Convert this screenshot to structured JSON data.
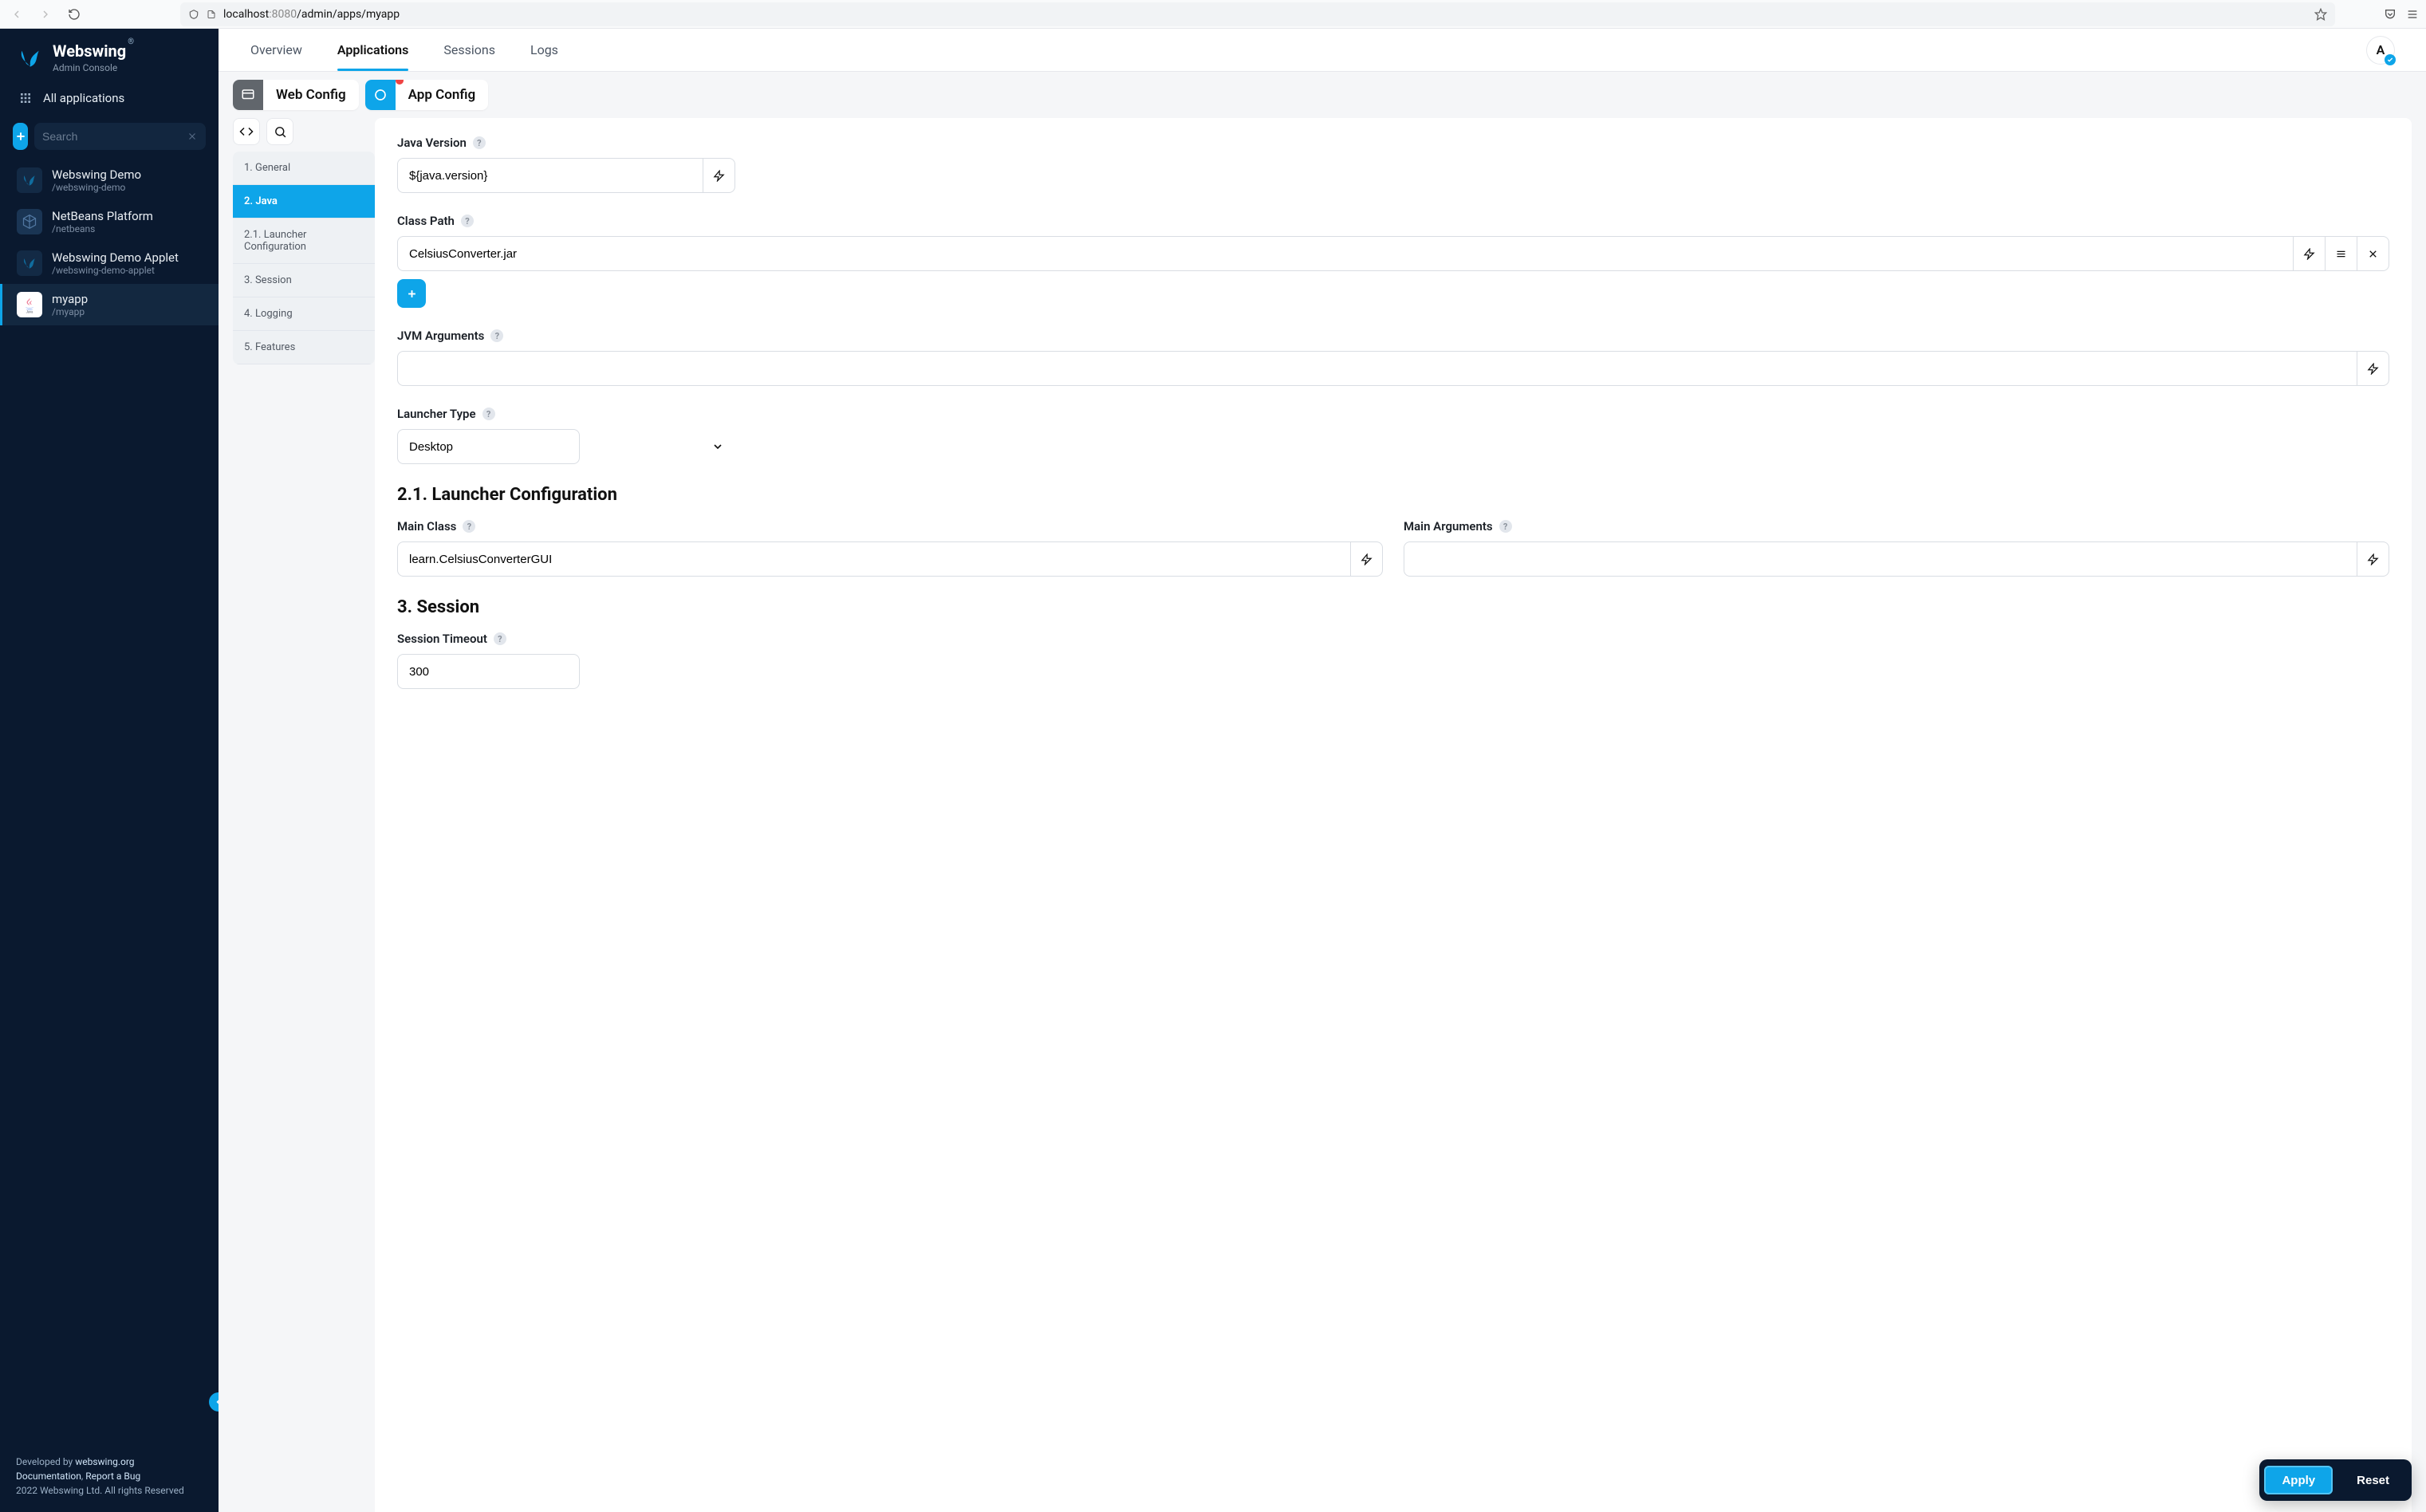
{
  "browser": {
    "url_host": "localhost",
    "url_port": ":8080",
    "url_path": "/admin/apps/myapp"
  },
  "brand": {
    "title": "Webswing",
    "subtitle": "Admin Console",
    "reg": "®"
  },
  "sidebar": {
    "all_apps": "All applications",
    "search_placeholder": "Search",
    "apps": [
      {
        "name": "Webswing Demo",
        "path": "/webswing-demo",
        "icon": "ws"
      },
      {
        "name": "NetBeans Platform",
        "path": "/netbeans",
        "icon": "cube"
      },
      {
        "name": "Webswing Demo Applet",
        "path": "/webswing-demo-applet",
        "icon": "ws"
      },
      {
        "name": "myapp",
        "path": "/myapp",
        "icon": "java"
      }
    ],
    "footer": {
      "l1a": "Developed by ",
      "l1b": "webswing.org",
      "l2a": "Documentation",
      "l2b": ", ",
      "l2c": "Report a Bug",
      "l3": "2022 Webswing Ltd. All rights Reserved"
    }
  },
  "topnav": {
    "tabs": [
      "Overview",
      "Applications",
      "Sessions",
      "Logs"
    ],
    "avatar_initial": "A"
  },
  "cfgtabs": {
    "web": "Web Config",
    "app": "App Config"
  },
  "toc": [
    "1. General",
    "2. Java",
    "2.1. Launcher Configuration",
    "3. Session",
    "4. Logging",
    "5. Features"
  ],
  "form": {
    "java_version_label": "Java Version",
    "java_version_value": "${java.version}",
    "class_path_label": "Class Path",
    "class_path_value": "CelsiusConverter.jar",
    "jvm_args_label": "JVM Arguments",
    "jvm_args_value": "",
    "launcher_type_label": "Launcher Type",
    "launcher_type_value": "Desktop",
    "section_launcher": "2.1. Launcher Configuration",
    "main_class_label": "Main Class",
    "main_class_value": "learn.CelsiusConverterGUI",
    "main_args_label": "Main Arguments",
    "main_args_value": "",
    "section_session": "3. Session",
    "session_timeout_label": "Session Timeout",
    "session_timeout_value": "300"
  },
  "actions": {
    "apply": "Apply",
    "reset": "Reset"
  }
}
